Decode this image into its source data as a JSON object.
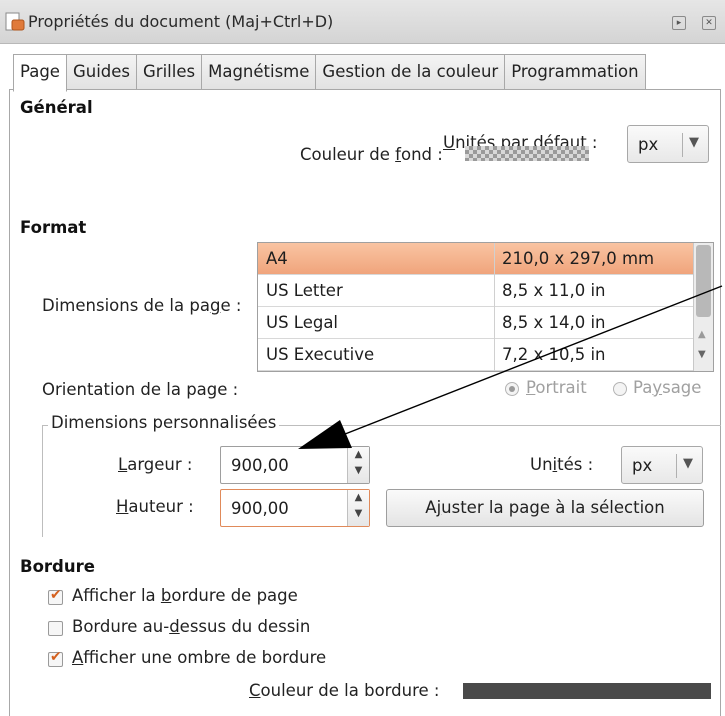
{
  "window": {
    "title": "Propriétés du document (Maj+Ctrl+D)",
    "btn_shade": "▸",
    "btn_close": "✕"
  },
  "tabs": [
    {
      "label": "Page",
      "active": true
    },
    {
      "label": "Guides"
    },
    {
      "label": "Grilles"
    },
    {
      "label": "Magnétisme"
    },
    {
      "label": "Gestion de la couleur"
    },
    {
      "label": "Programmation"
    }
  ],
  "general": {
    "heading": "Général",
    "units_label_u": "U",
    "units_label_rest": "nités par défaut :",
    "units_value": "px",
    "bg_label_a": "Couleur de ",
    "bg_label_u": "f",
    "bg_label_b": "ond :"
  },
  "format": {
    "heading": "Format",
    "dims_label_a": "Dimensions de la pa",
    "dims_label_u": "g",
    "dims_label_b": "e :",
    "list": [
      {
        "name": "A4",
        "size": "210,0 x 297,0 mm",
        "selected": true
      },
      {
        "name": "US Letter",
        "size": "8,5 x 11,0 in"
      },
      {
        "name": "US Legal",
        "size": "8,5 x 14,0 in"
      },
      {
        "name": "US Executive",
        "size": "7,2 x 10,5 in"
      }
    ],
    "orientation_label": "Orientation de la page :",
    "portrait_u": "P",
    "portrait_rest": "ortrait",
    "landscape_a": "Pa",
    "landscape_u": "y",
    "landscape_b": "sage"
  },
  "custom": {
    "title": "Dimensions personnalisées",
    "width_u": "L",
    "width_rest": "argeur :",
    "width_value": "900,00",
    "height_u": "H",
    "height_rest": "auteur :",
    "height_value": "900,00",
    "units_a": "Un",
    "units_u": "i",
    "units_b": "tés :",
    "units_value": "px",
    "fit_a": "A",
    "fit_u": "j",
    "fit_b": "uster la page à la sélection"
  },
  "border": {
    "heading": "Bordure",
    "show_a": "Afficher la ",
    "show_u": "b",
    "show_b": "ordure de page",
    "above_a": "Bordure au-",
    "above_u": "d",
    "above_b": "essus du dessin",
    "shadow_u": "A",
    "shadow_rest": "fficher une ombre de bordure",
    "color_u": "C",
    "color_rest": "ouleur de la bordure :",
    "show_checked": true,
    "above_checked": false,
    "shadow_checked": true,
    "color_value": "#4a4a4a"
  },
  "colors": {
    "selection": "#f0a47c",
    "check_accent": "#d4601e"
  }
}
